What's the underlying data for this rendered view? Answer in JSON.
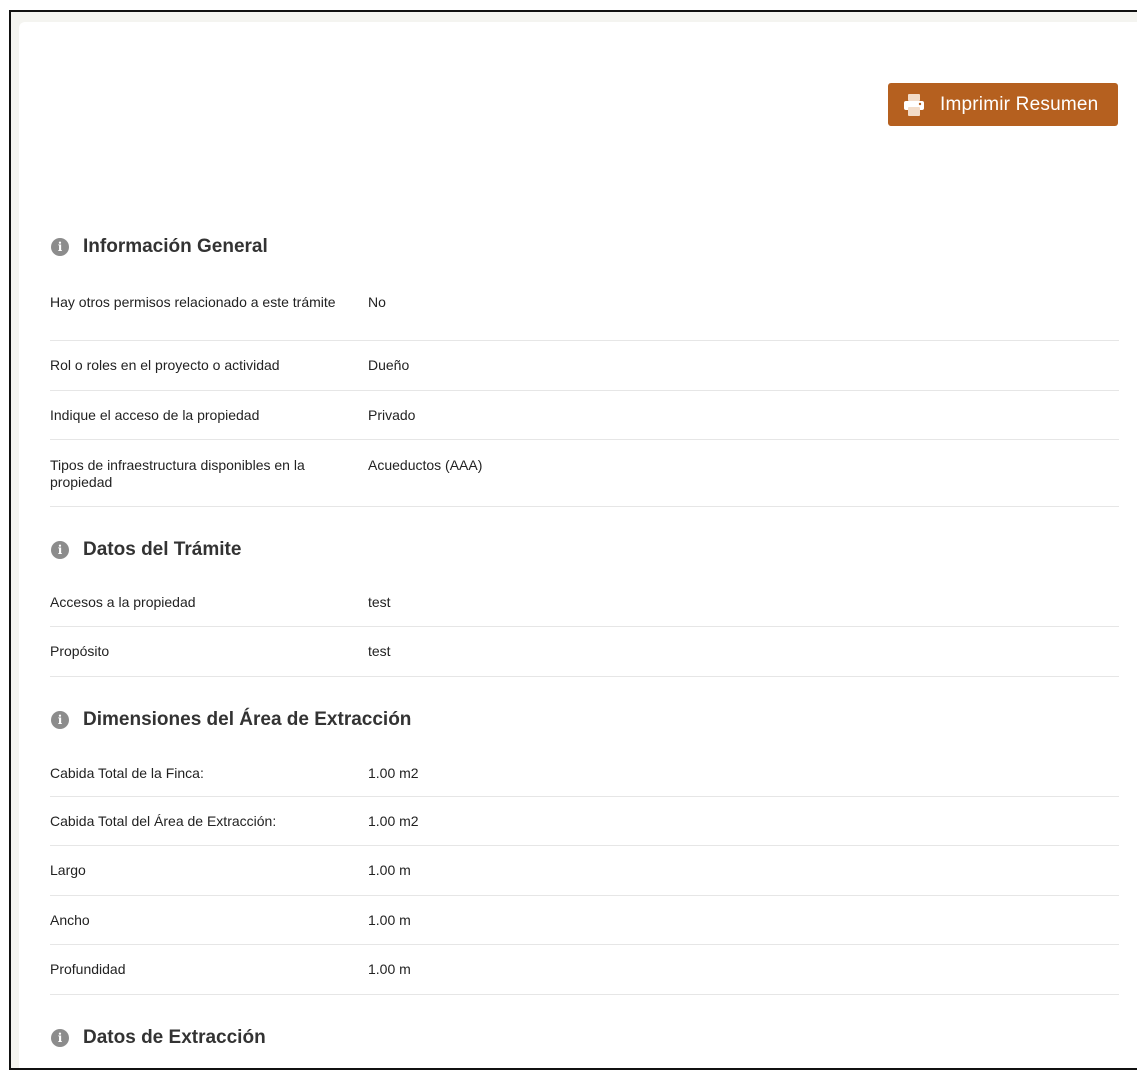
{
  "header": {
    "print_button_label": "Imprimir Resumen",
    "print_icon": "printer-icon",
    "accent_color": "#b5601f"
  },
  "sections": [
    {
      "title": "Información General",
      "icon": "info-icon",
      "rows": [
        {
          "label": "Hay otros permisos relacionado a este trámite",
          "value": "No"
        },
        {
          "label": "Rol o roles en el proyecto o actividad",
          "value": "Dueño"
        },
        {
          "label": "Indique el acceso de la propiedad",
          "value": "Privado"
        },
        {
          "label": "Tipos de infraestructura disponibles en la propiedad",
          "value": "Acueductos (AAA)"
        }
      ]
    },
    {
      "title": "Datos del Trámite",
      "icon": "info-icon",
      "rows": [
        {
          "label": "Accesos a la propiedad",
          "value": "test"
        },
        {
          "label": "Propósito",
          "value": "test"
        }
      ]
    },
    {
      "title": "Dimensiones del Área de Extracción",
      "icon": "info-icon",
      "rows": [
        {
          "label": "Cabida Total de la Finca:",
          "value": "1.00 m2"
        },
        {
          "label": "Cabida Total del Área de Extracción:",
          "value": "1.00 m2"
        },
        {
          "label": "Largo",
          "value": "1.00 m"
        },
        {
          "label": "Ancho",
          "value": "1.00 m"
        },
        {
          "label": "Profundidad",
          "value": "1.00 m"
        }
      ]
    },
    {
      "title": "Datos de Extracción",
      "icon": "info-icon",
      "rows": []
    }
  ]
}
